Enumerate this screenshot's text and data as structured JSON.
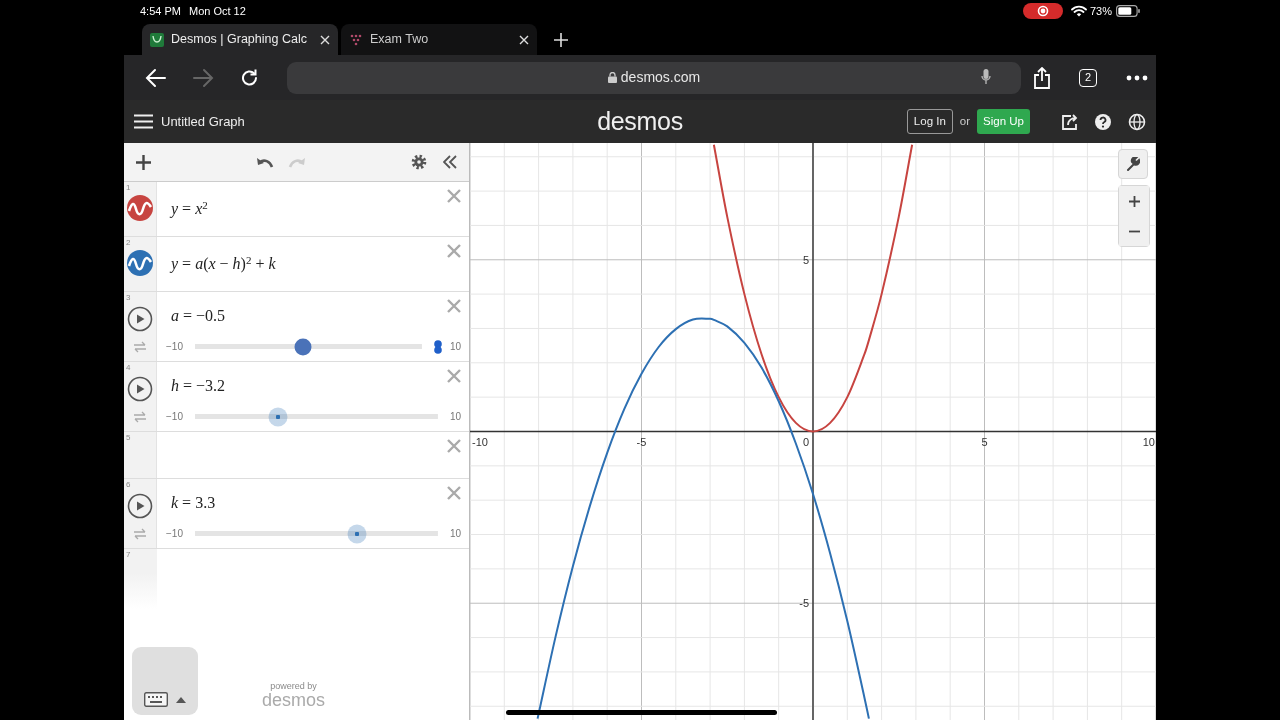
{
  "status_bar": {
    "time": "4:54 PM",
    "date": "Mon Oct 12",
    "recording": true,
    "battery": "73%"
  },
  "browser": {
    "tabs": [
      {
        "title": "Desmos | Graphing Calc",
        "selected": true
      },
      {
        "title": "Exam Two",
        "selected": false
      }
    ],
    "back_disabled": false,
    "forward_disabled": true,
    "url": "desmos.com",
    "tab_count": "2"
  },
  "header": {
    "title": "Untitled Graph",
    "logo": "desmos",
    "login": "Log In",
    "or": "or",
    "signup": "Sign Up"
  },
  "toolbar": {
    "undo_disabled": false,
    "redo_disabled": true
  },
  "expressions": [
    {
      "number": "1",
      "kind": "graph",
      "color": "#c74440",
      "latex": "*y* = *x*$^{2}$"
    },
    {
      "number": "2",
      "kind": "graph",
      "color": "#2d70b3",
      "latex": "*y* = *a*(*x* − *h*)$^{2}$ + *k*"
    },
    {
      "number": "3",
      "kind": "slider",
      "latex": "*a* = −0.5",
      "min": "−10",
      "max": "10",
      "level": 0.475,
      "active": true
    },
    {
      "number": "4",
      "kind": "slider",
      "latex": "*h* = −3.2",
      "min": "−10",
      "max": "10",
      "level": 0.34,
      "active": false
    },
    {
      "number": "5",
      "kind": "empty"
    },
    {
      "number": "6",
      "kind": "slider",
      "latex": "*k* = 3.3",
      "min": "−10",
      "max": "10",
      "level": 0.665,
      "active": false
    },
    {
      "number": "7",
      "kind": "new"
    }
  ],
  "footer": {
    "powered_by": "powered by",
    "logo": "desmos"
  },
  "graph": {
    "chart_data": {
      "type": "line",
      "grid": true,
      "x": [
        -8.03,
        -7.5,
        -7,
        -6.5,
        -6,
        -5.5,
        -5,
        -4.5,
        -4,
        -3.5,
        -3,
        -2.89,
        -2.5,
        -2,
        -1.5,
        -1,
        -0.5,
        0,
        0.5,
        1,
        1.5,
        1.63,
        2,
        2.5,
        2.89
      ],
      "series": [
        {
          "color": "#c74440",
          "values": [
            null,
            null,
            null,
            null,
            null,
            null,
            null,
            null,
            null,
            null,
            null,
            8.35,
            6.25,
            4,
            2.25,
            1,
            0.25,
            0,
            0.25,
            1,
            2.25,
            2.66,
            4,
            6.25,
            8.35
          ]
        },
        {
          "color": "#2d70b3",
          "values": [
            -8.36,
            -5.95,
            -3.92,
            -2.15,
            -0.62,
            0.66,
            1.68,
            2.46,
            2.98,
            3.26,
            3.28,
            3.25,
            3.06,
            2.58,
            1.86,
            0.88,
            -0.35,
            -1.82,
            -3.55,
            -5.52,
            -7.75,
            -8.36,
            null,
            null,
            null
          ]
        }
      ],
      "xlim": [
        -10,
        10
      ],
      "ylim": [
        -8.4,
        8.4
      ],
      "xticks": [
        -10,
        -5,
        0,
        5,
        10
      ],
      "yticks": [
        -5,
        5
      ]
    }
  }
}
